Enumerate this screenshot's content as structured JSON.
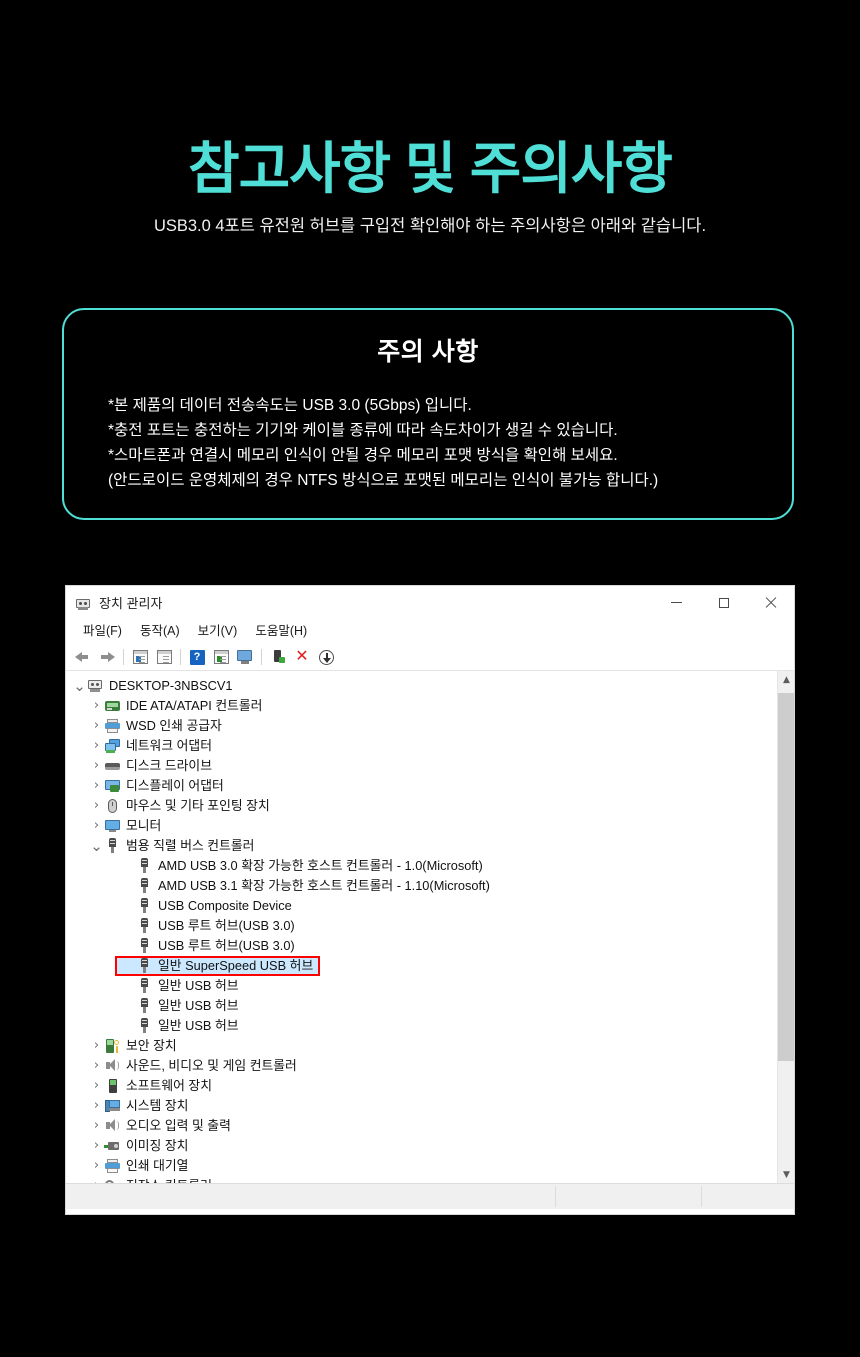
{
  "hero": {
    "title": "참고사항 및 주의사항",
    "subtitle": "USB3.0 4포트 유전원 허브를 구입전 확인해야 하는 주의사항은 아래와 같습니다.",
    "accent_color": "#4fdfd6"
  },
  "notice": {
    "title": "주의 사항",
    "border_color": "#4fdfd6",
    "lines": [
      "*본 제품의 데이터 전송속도는 USB 3.0 (5Gbps) 입니다.",
      "*충전 포트는 충전하는 기기와 케이블 종류에 따라 속도차이가 생길 수 있습니다.",
      "*스마트폰과 연결시 메모리 인식이 안될 경우 메모리 포맷 방식을 확인해 보세요.",
      " (안드로이드 운영체제의 경우 NTFS 방식으로 포맷된 메모리는 인식이 불가능 합니다.)"
    ]
  },
  "device_manager": {
    "window_title": "장치 관리자",
    "window_icon": "computer-icon",
    "window_buttons": {
      "minimize": "minimize-icon",
      "maximize": "maximize-icon",
      "close": "close-icon"
    },
    "menu": [
      {
        "label": "파일(F)"
      },
      {
        "label": "동작(A)"
      },
      {
        "label": "보기(V)"
      },
      {
        "label": "도움말(H)"
      }
    ],
    "toolbar": [
      {
        "name": "back-arrow-icon"
      },
      {
        "name": "forward-arrow-icon"
      },
      {
        "name": "separator"
      },
      {
        "name": "properties-panel-icon"
      },
      {
        "name": "update-driver-icon"
      },
      {
        "name": "separator"
      },
      {
        "name": "help-icon"
      },
      {
        "name": "show-hidden-devices-icon"
      },
      {
        "name": "scan-hardware-changes-icon"
      },
      {
        "name": "separator"
      },
      {
        "name": "enable-device-icon"
      },
      {
        "name": "uninstall-device-icon"
      },
      {
        "name": "download-driver-icon"
      }
    ],
    "tree": [
      {
        "level": 0,
        "chevron": "v",
        "icon": "computer-icon",
        "label": "DESKTOP-3NBSCV1",
        "selected": false
      },
      {
        "level": 1,
        "chevron": ">",
        "icon": "ide-controller-icon",
        "label": "IDE ATA/ATAPI 컨트롤러",
        "selected": false
      },
      {
        "level": 1,
        "chevron": ">",
        "icon": "printer-icon",
        "label": "WSD 인쇄 공급자",
        "selected": false
      },
      {
        "level": 1,
        "chevron": ">",
        "icon": "network-adapter-icon",
        "label": "네트워크 어댑터",
        "selected": false
      },
      {
        "level": 1,
        "chevron": ">",
        "icon": "disk-drive-icon",
        "label": "디스크 드라이브",
        "selected": false
      },
      {
        "level": 1,
        "chevron": ">",
        "icon": "display-adapter-icon",
        "label": "디스플레이 어댑터",
        "selected": false
      },
      {
        "level": 1,
        "chevron": ">",
        "icon": "mouse-icon",
        "label": "마우스 및 기타 포인팅 장치",
        "selected": false
      },
      {
        "level": 1,
        "chevron": ">",
        "icon": "monitor-icon",
        "label": "모니터",
        "selected": false
      },
      {
        "level": 1,
        "chevron": "v",
        "icon": "usb-icon",
        "label": "범용 직렬 버스 컨트롤러",
        "selected": false
      },
      {
        "level": 2,
        "chevron": "",
        "icon": "usb-icon",
        "label": "AMD USB 3.0 확장 가능한 호스트 컨트롤러 - 1.0(Microsoft)",
        "selected": false
      },
      {
        "level": 2,
        "chevron": "",
        "icon": "usb-icon",
        "label": "AMD USB 3.1 확장 가능한 호스트 컨트롤러 - 1.10(Microsoft)",
        "selected": false
      },
      {
        "level": 2,
        "chevron": "",
        "icon": "usb-icon",
        "label": "USB Composite Device",
        "selected": false
      },
      {
        "level": 2,
        "chevron": "",
        "icon": "usb-icon",
        "label": "USB 루트 허브(USB 3.0)",
        "selected": false
      },
      {
        "level": 2,
        "chevron": "",
        "icon": "usb-icon",
        "label": "USB 루트 허브(USB 3.0)",
        "selected": false
      },
      {
        "level": 2,
        "chevron": "",
        "icon": "usb-icon",
        "label": "일반 SuperSpeed USB 허브",
        "selected": true
      },
      {
        "level": 2,
        "chevron": "",
        "icon": "usb-icon",
        "label": "일반 USB 허브",
        "selected": false
      },
      {
        "level": 2,
        "chevron": "",
        "icon": "usb-icon",
        "label": "일반 USB 허브",
        "selected": false
      },
      {
        "level": 2,
        "chevron": "",
        "icon": "usb-icon",
        "label": "일반 USB 허브",
        "selected": false
      },
      {
        "level": 1,
        "chevron": ">",
        "icon": "security-device-icon",
        "label": "보안 장치",
        "selected": false
      },
      {
        "level": 1,
        "chevron": ">",
        "icon": "sound-icon",
        "label": "사운드, 비디오 및 게임 컨트롤러",
        "selected": false
      },
      {
        "level": 1,
        "chevron": ">",
        "icon": "software-device-icon",
        "label": "소프트웨어 장치",
        "selected": false
      },
      {
        "level": 1,
        "chevron": ">",
        "icon": "system-device-icon",
        "label": "시스템 장치",
        "selected": false
      },
      {
        "level": 1,
        "chevron": ">",
        "icon": "audio-io-icon",
        "label": "오디오 입력 및 출력",
        "selected": false
      },
      {
        "level": 1,
        "chevron": ">",
        "icon": "imaging-device-icon",
        "label": "이미징 장치",
        "selected": false
      },
      {
        "level": 1,
        "chevron": ">",
        "icon": "print-queue-icon",
        "label": "인쇄 대기열",
        "selected": false
      },
      {
        "level": 1,
        "chevron": ">",
        "icon": "storage-controller-icon",
        "label": "저장소 컨트롤러",
        "selected": false
      }
    ],
    "selection": {
      "highlight_color": "#cce8ff",
      "outline_color": "#ff0000"
    },
    "scrollbar": {
      "up_arrow": "chevron-up-icon",
      "down_arrow": "chevron-down-icon"
    },
    "status_bar": {
      "text": ""
    }
  }
}
